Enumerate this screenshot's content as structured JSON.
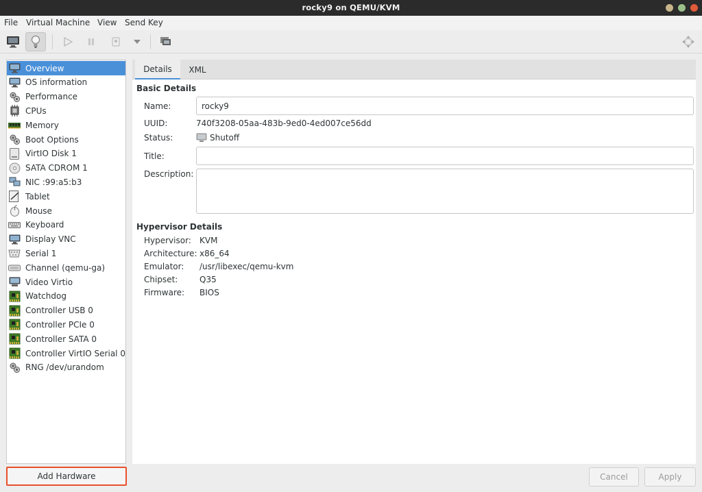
{
  "window": {
    "title": "rocky9 on QEMU/KVM"
  },
  "menubar": {
    "items": [
      "File",
      "Virtual Machine",
      "View",
      "Send Key"
    ]
  },
  "toolbar": {
    "buttons": [
      {
        "name": "console-view",
        "icon": "monitor-icon"
      },
      {
        "name": "details-view",
        "icon": "lightbulb-icon",
        "active": true
      },
      {
        "name": "run",
        "icon": "play-icon"
      },
      {
        "name": "pause",
        "icon": "pause-icon"
      },
      {
        "name": "shutdown",
        "icon": "power-icon"
      },
      {
        "name": "shutdown-menu",
        "icon": "dropdown-arrow-icon"
      },
      {
        "name": "snapshots",
        "icon": "snapshots-icon"
      },
      {
        "name": "fullscreen",
        "icon": "resize-icon"
      }
    ]
  },
  "sidebar": {
    "items": [
      {
        "label": "Overview",
        "icon": "monitor-icon",
        "selected": true
      },
      {
        "label": "OS information",
        "icon": "monitor-icon"
      },
      {
        "label": "Performance",
        "icon": "gears-icon"
      },
      {
        "label": "CPUs",
        "icon": "cpu-icon"
      },
      {
        "label": "Memory",
        "icon": "memory-icon"
      },
      {
        "label": "Boot Options",
        "icon": "gears-icon"
      },
      {
        "label": "VirtIO Disk 1",
        "icon": "disk-icon"
      },
      {
        "label": "SATA CDROM 1",
        "icon": "cdrom-icon"
      },
      {
        "label": "NIC :99:a5:b3",
        "icon": "network-icon"
      },
      {
        "label": "Tablet",
        "icon": "tablet-icon"
      },
      {
        "label": "Mouse",
        "icon": "mouse-icon"
      },
      {
        "label": "Keyboard",
        "icon": "keyboard-icon"
      },
      {
        "label": "Display VNC",
        "icon": "monitor-icon"
      },
      {
        "label": "Serial 1",
        "icon": "serial-icon"
      },
      {
        "label": "Channel (qemu-ga)",
        "icon": "channel-icon"
      },
      {
        "label": "Video Virtio",
        "icon": "video-icon"
      },
      {
        "label": "Watchdog",
        "icon": "pcb-icon"
      },
      {
        "label": "Controller USB 0",
        "icon": "pcb-icon"
      },
      {
        "label": "Controller PCIe 0",
        "icon": "pcb-icon"
      },
      {
        "label": "Controller SATA 0",
        "icon": "pcb-icon"
      },
      {
        "label": "Controller VirtIO Serial 0",
        "icon": "pcb-icon"
      },
      {
        "label": "RNG /dev/urandom",
        "icon": "gears-icon"
      }
    ],
    "add_hardware_label": "Add Hardware"
  },
  "tabs": [
    {
      "label": "Details",
      "selected": true
    },
    {
      "label": "XML"
    }
  ],
  "basic_details": {
    "heading": "Basic Details",
    "name_label": "Name:",
    "name_value": "rocky9",
    "uuid_label": "UUID:",
    "uuid_value": "740f3208-05aa-483b-9ed0-4ed007ce56dd",
    "status_label": "Status:",
    "status_value": "Shutoff",
    "title_label": "Title:",
    "title_value": "",
    "description_label": "Description:",
    "description_value": ""
  },
  "hypervisor_details": {
    "heading": "Hypervisor Details",
    "hypervisor_label": "Hypervisor:",
    "hypervisor_value": "KVM",
    "architecture_label": "Architecture:",
    "architecture_value": "x86_64",
    "emulator_label": "Emulator:",
    "emulator_value": "/usr/libexec/qemu-kvm",
    "chipset_label": "Chipset:",
    "chipset_value": "Q35",
    "firmware_label": "Firmware:",
    "firmware_value": "BIOS"
  },
  "footer": {
    "cancel_label": "Cancel",
    "apply_label": "Apply"
  },
  "colors": {
    "selection": "#4a90d9",
    "highlight_border": "#e8502b",
    "titlebar": "#2b2b2b"
  }
}
